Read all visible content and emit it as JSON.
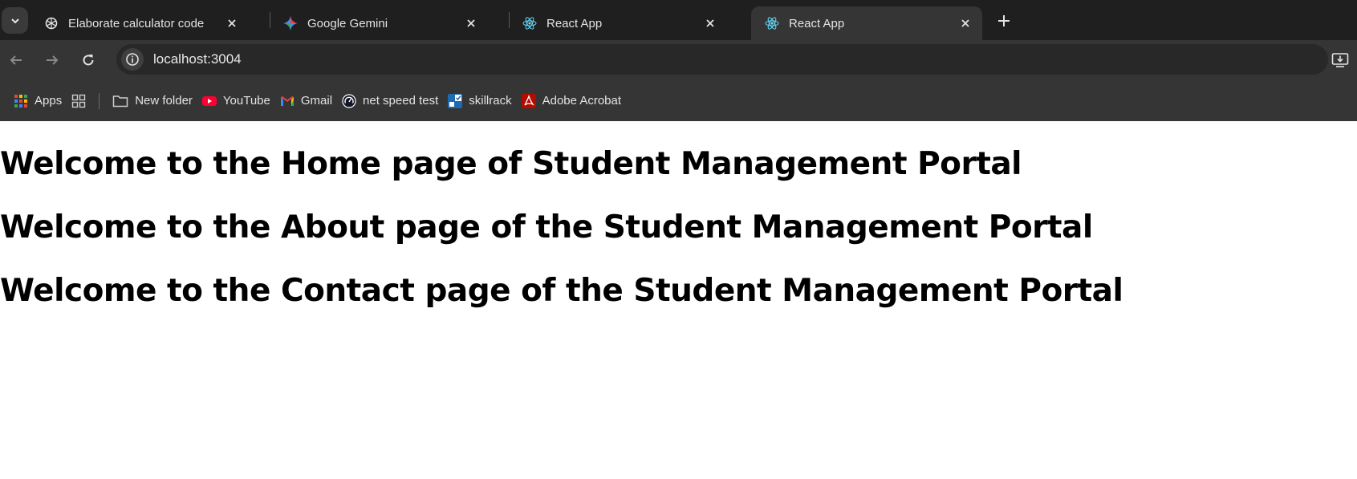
{
  "browser": {
    "tabs": [
      {
        "title": "Elaborate calculator code",
        "icon": "openai-icon",
        "active": false
      },
      {
        "title": "Google Gemini",
        "icon": "gemini-icon",
        "active": false
      },
      {
        "title": "React App",
        "icon": "react-icon",
        "active": false
      },
      {
        "title": "React App",
        "icon": "react-icon",
        "active": true
      }
    ],
    "url": "localhost:3004",
    "bookmarks": [
      {
        "label": "Apps",
        "icon": "apps-grid-icon"
      },
      {
        "label": "New folder",
        "icon": "folder-icon"
      },
      {
        "label": "YouTube",
        "icon": "youtube-icon"
      },
      {
        "label": "Gmail",
        "icon": "gmail-icon"
      },
      {
        "label": "net speed test",
        "icon": "speedometer-icon"
      },
      {
        "label": "skillrack",
        "icon": "skillrack-icon"
      },
      {
        "label": "Adobe Acrobat",
        "icon": "acrobat-icon"
      }
    ]
  },
  "page": {
    "headings": [
      "Welcome to the Home page of Student Management Portal",
      "Welcome to the About page of the Student Management Portal",
      "Welcome to the Contact page of the Student Management Portal"
    ]
  },
  "colors": {
    "tabstrip_bg": "#1f1f1f",
    "toolbar_bg": "#353535",
    "omnibox_bg": "#282828",
    "page_bg": "#ffffff",
    "heading_text": "#000000"
  }
}
